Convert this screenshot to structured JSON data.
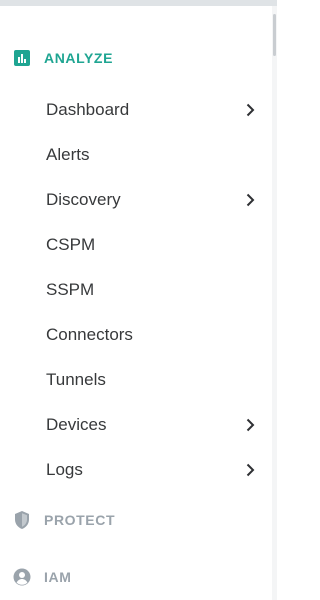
{
  "sections": {
    "analyze": {
      "label": "ANALYZE",
      "icon": "bar-chart-icon",
      "color": "#1fa592"
    },
    "protect": {
      "label": "PROTECT",
      "icon": "shield-icon",
      "color": "#9aa3ab"
    },
    "iam": {
      "label": "IAM",
      "icon": "user-circle-icon",
      "color": "#9aa3ab"
    }
  },
  "analyze_items": [
    {
      "label": "Dashboard",
      "has_submenu": true
    },
    {
      "label": "Alerts",
      "has_submenu": false
    },
    {
      "label": "Discovery",
      "has_submenu": true
    },
    {
      "label": "CSPM",
      "has_submenu": false
    },
    {
      "label": "SSPM",
      "has_submenu": false
    },
    {
      "label": "Connectors",
      "has_submenu": false
    },
    {
      "label": "Tunnels",
      "has_submenu": false
    },
    {
      "label": "Devices",
      "has_submenu": true
    },
    {
      "label": "Logs",
      "has_submenu": true
    }
  ]
}
